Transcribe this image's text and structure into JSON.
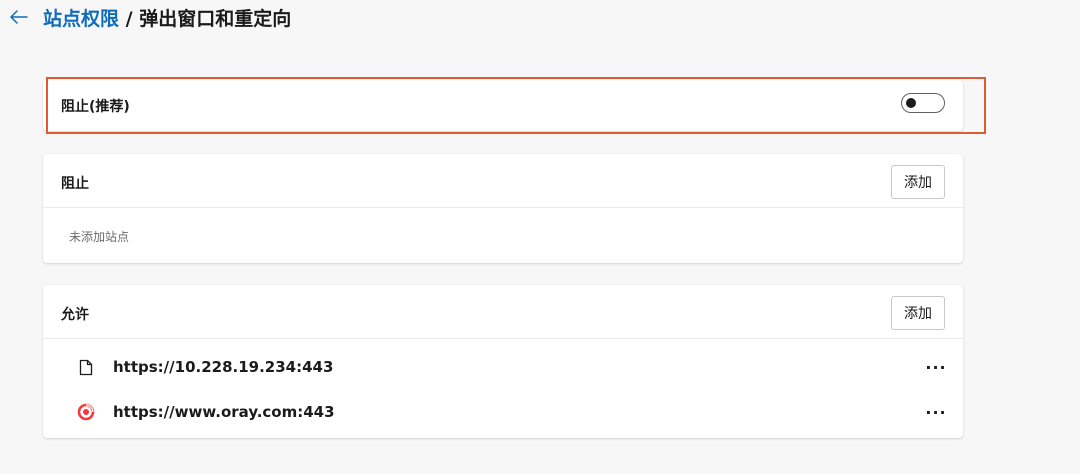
{
  "header": {
    "breadcrumb_parent": "站点权限",
    "separator": " / ",
    "page_title": "弹出窗口和重定向"
  },
  "toggle_card": {
    "label": "阻止(推荐)",
    "toggle_state": "off"
  },
  "block_section": {
    "title": "阻止",
    "add_label": "添加",
    "empty_text": "未添加站点"
  },
  "allow_section": {
    "title": "允许",
    "add_label": "添加",
    "sites": [
      {
        "url": "https://10.228.19.234:443",
        "icon": "file-icon"
      },
      {
        "url": "https://www.oray.com:443",
        "icon": "oray-logo-icon"
      }
    ],
    "more_label": "···"
  },
  "colors": {
    "link": "#0f6cbd",
    "highlight_border": "#e05a33",
    "oray_red": "#f23a3c",
    "background": "#f7f7f7"
  }
}
